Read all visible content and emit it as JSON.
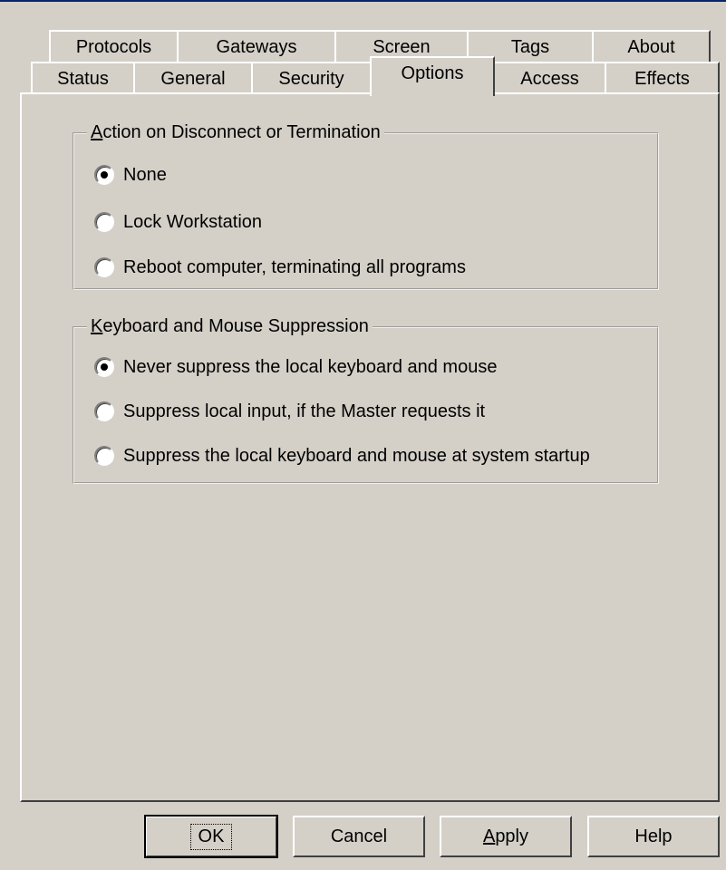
{
  "tabs_back_row": [
    {
      "label": "Protocols"
    },
    {
      "label": "Gateways"
    },
    {
      "label": "Screen"
    },
    {
      "label": "Tags"
    },
    {
      "label": "About"
    }
  ],
  "tabs_front_row": [
    {
      "label": "Status"
    },
    {
      "label": "General"
    },
    {
      "label": "Security"
    },
    {
      "label": "Options",
      "selected": true
    },
    {
      "label": "Access"
    },
    {
      "label": "Effects"
    }
  ],
  "disconnect_group": {
    "caption_first": "A",
    "caption_rest": "ction on Disconnect or Termination",
    "options": [
      {
        "label": "None",
        "checked": true
      },
      {
        "label": "Lock Workstation",
        "checked": false
      },
      {
        "label": "Reboot computer, terminating all programs",
        "checked": false
      }
    ]
  },
  "suppression_group": {
    "caption_first": "K",
    "caption_rest": "eyboard and Mouse Suppression",
    "options": [
      {
        "label": "Never suppress the local keyboard and mouse",
        "checked": true
      },
      {
        "label": "Suppress local input, if the Master requests it",
        "checked": false
      },
      {
        "label": "Suppress the local keyboard and mouse at system startup",
        "checked": false
      }
    ]
  },
  "buttons": {
    "ok": "OK",
    "cancel": "Cancel",
    "apply_first": "A",
    "apply_rest": "pply",
    "help": "Help"
  }
}
